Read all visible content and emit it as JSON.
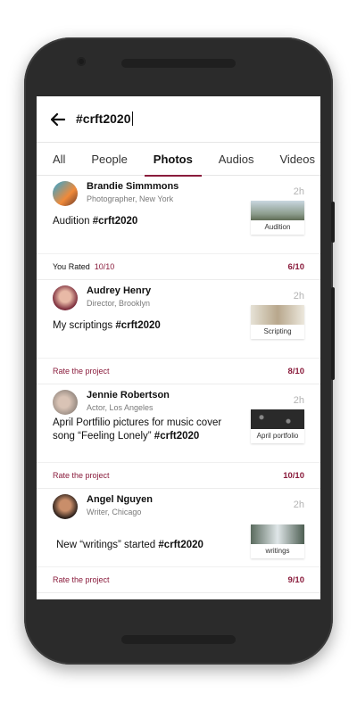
{
  "search": {
    "query": "#crft2020"
  },
  "tabs": [
    {
      "label": "All"
    },
    {
      "label": "People"
    },
    {
      "label": "Photos"
    },
    {
      "label": "Audios"
    },
    {
      "label": "Videos"
    }
  ],
  "colors": {
    "accent": "#8a1c3c"
  },
  "posts": [
    {
      "name": "Brandie Simmmons",
      "subtitle": "Photographer, New York",
      "time": "2h",
      "text": "Audition",
      "hashtag": "#crft2020",
      "thumb_caption": "Audition",
      "rate_label": "You Rated",
      "rate_value": "10/10",
      "score": "6/10"
    },
    {
      "name": "Audrey Henry",
      "subtitle": "Director, Brooklyn",
      "time": "2h",
      "text": "My scriptings",
      "hashtag": "#crft2020",
      "thumb_caption": "Scripting",
      "rate_label": "Rate the project",
      "score": "8/10"
    },
    {
      "name": "Jennie Robertson",
      "subtitle": "Actor, Los Angeles",
      "time": "2h",
      "text_line1": "April Portfilio pictures for music cover",
      "text_line2": "song “Feeling Lonely”",
      "hashtag": "#crft2020",
      "thumb_caption": "April portfolio",
      "rate_label": "Rate the project",
      "score": "10/10"
    },
    {
      "name": "Angel Nguyen",
      "subtitle": "Writer, Chicago",
      "time": "2h",
      "text": "New “writings” started",
      "hashtag": "#crft2020",
      "thumb_caption": "writings",
      "rate_label": "Rate the project",
      "score": "9/10"
    }
  ]
}
